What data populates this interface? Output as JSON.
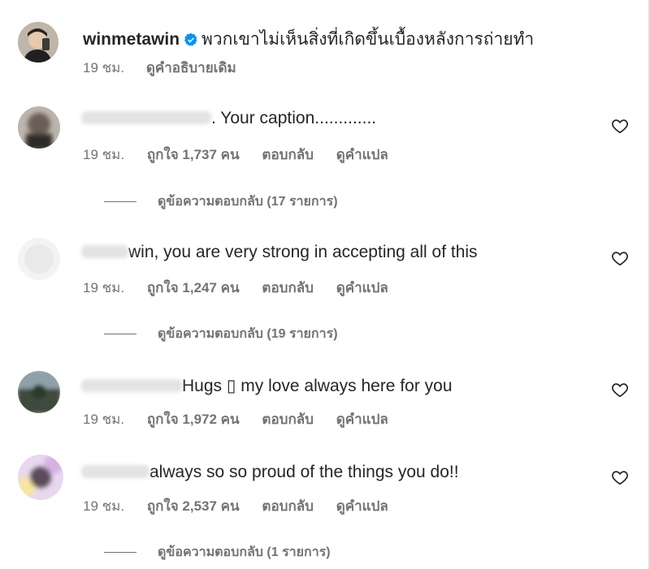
{
  "caption": {
    "username": "winmetawin",
    "text": "พวกเขาไม่เห็นสิ่งที่เกิดขึ้นเบื้องหลังการถ่ายทำ",
    "time": "19 ชม.",
    "see_translation": "ดูคำอธิบายเดิม"
  },
  "comments": [
    {
      "text": ". Your caption.............",
      "time": "19 ชม.",
      "likes": "ถูกใจ 1,737 คน",
      "reply": "ตอบกลับ",
      "translate": "ดูคำแปล",
      "view_replies": "ดูข้อความตอบกลับ (17 รายการ)"
    },
    {
      "text": "win, you are very strong in accepting all of this",
      "time": "19 ชม.",
      "likes": "ถูกใจ 1,247 คน",
      "reply": "ตอบกลับ",
      "translate": "ดูคำแปล",
      "view_replies": "ดูข้อความตอบกลับ (19 รายการ)"
    },
    {
      "text": "Hugs ▯ my love always here for you",
      "time": "19 ชม.",
      "likes": "ถูกใจ 1,972 คน",
      "reply": "ตอบกลับ",
      "translate": "ดูคำแปล"
    },
    {
      "text": "always so so proud of the things you do!!",
      "time": "19 ชม.",
      "likes": "ถูกใจ 2,537 คน",
      "reply": "ตอบกลับ",
      "translate": "ดูคำแปล",
      "view_replies": "ดูข้อความตอบกลับ (1 รายการ)"
    }
  ],
  "icons": {
    "verified": "verified-badge-icon",
    "like": "heart-outline-icon"
  },
  "colors": {
    "verified": "#0095f6",
    "secondary_text": "#737373"
  }
}
